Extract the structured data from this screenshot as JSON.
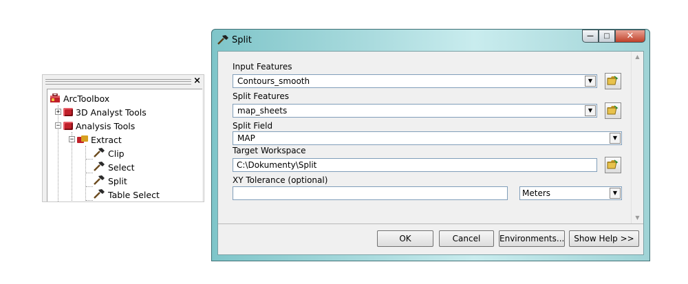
{
  "toolbox": {
    "close_glyph": "×",
    "items": [
      {
        "label": "ArcToolbox",
        "expander": ""
      },
      {
        "label": "3D Analyst Tools",
        "expander": "+"
      },
      {
        "label": "Analysis Tools",
        "expander": "−"
      },
      {
        "label": "Extract",
        "expander": "−"
      },
      {
        "label": "Clip",
        "expander": ""
      },
      {
        "label": "Select",
        "expander": ""
      },
      {
        "label": "Split",
        "expander": ""
      },
      {
        "label": "Table Select",
        "expander": ""
      }
    ]
  },
  "dialog": {
    "title": "Split",
    "window_buttons": {
      "minimize": "—",
      "maximize": "□",
      "close": "✕"
    },
    "params": {
      "input_features": {
        "label": "Input Features",
        "value": "Contours_smooth"
      },
      "split_features": {
        "label": "Split Features",
        "value": "map_sheets"
      },
      "split_field": {
        "label": "Split Field",
        "value": "MAP"
      },
      "target_workspace": {
        "label": "Target Workspace",
        "value": "C:\\Dokumenty\\Split"
      },
      "xy_tolerance": {
        "label": "XY Tolerance (optional)",
        "value": "",
        "unit": "Meters"
      }
    },
    "buttons": {
      "ok": "OK",
      "cancel": "Cancel",
      "environments": "Environments...",
      "show_help": "Show Help >>"
    }
  },
  "icons": {
    "hammer": "hammer-icon",
    "toolbox": "toolbox-icon",
    "folder": "open-folder-icon",
    "dropdown": "chevron-down-icon"
  }
}
